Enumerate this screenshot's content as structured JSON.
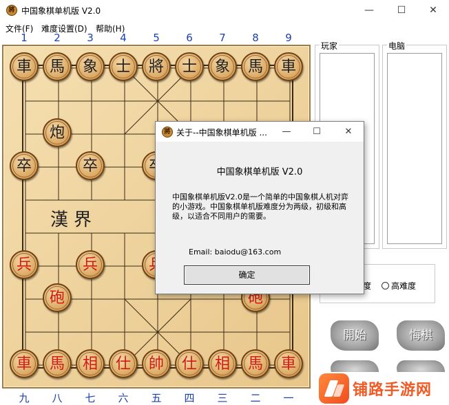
{
  "window": {
    "title": "中国象棋单机版 V2.0",
    "icon_char": "將"
  },
  "menu": [
    "文件(F)",
    "难度设置(D)",
    "帮助(H)"
  ],
  "top_numbers": [
    "1",
    "2",
    "3",
    "4",
    "5",
    "6",
    "7",
    "8",
    "9"
  ],
  "bottom_numbers": [
    "九",
    "八",
    "七",
    "六",
    "五",
    "四",
    "三",
    "二",
    "一"
  ],
  "river_text": "漢界",
  "pieces": [
    {
      "char": "車",
      "side": "black",
      "col": 0,
      "row": 0
    },
    {
      "char": "馬",
      "side": "black",
      "col": 1,
      "row": 0
    },
    {
      "char": "象",
      "side": "black",
      "col": 2,
      "row": 0
    },
    {
      "char": "士",
      "side": "black",
      "col": 3,
      "row": 0
    },
    {
      "char": "將",
      "side": "black",
      "col": 4,
      "row": 0
    },
    {
      "char": "士",
      "side": "black",
      "col": 5,
      "row": 0
    },
    {
      "char": "象",
      "side": "black",
      "col": 6,
      "row": 0
    },
    {
      "char": "馬",
      "side": "black",
      "col": 7,
      "row": 0
    },
    {
      "char": "車",
      "side": "black",
      "col": 8,
      "row": 0
    },
    {
      "char": "炮",
      "side": "black",
      "col": 1,
      "row": 2
    },
    {
      "char": "卒",
      "side": "black",
      "col": 0,
      "row": 3
    },
    {
      "char": "卒",
      "side": "black",
      "col": 2,
      "row": 3
    },
    {
      "char": "卒",
      "side": "black",
      "col": 4,
      "row": 3
    },
    {
      "char": "兵",
      "side": "red",
      "col": 0,
      "row": 6
    },
    {
      "char": "兵",
      "side": "red",
      "col": 2,
      "row": 6
    },
    {
      "char": "兵",
      "side": "red",
      "col": 4,
      "row": 6
    },
    {
      "char": "砲",
      "side": "red",
      "col": 1,
      "row": 7
    },
    {
      "char": "砲",
      "side": "red",
      "col": 7,
      "row": 7
    },
    {
      "char": "車",
      "side": "red",
      "col": 0,
      "row": 9
    },
    {
      "char": "馬",
      "side": "red",
      "col": 1,
      "row": 9
    },
    {
      "char": "相",
      "side": "red",
      "col": 2,
      "row": 9
    },
    {
      "char": "仕",
      "side": "red",
      "col": 3,
      "row": 9
    },
    {
      "char": "帥",
      "side": "red",
      "col": 4,
      "row": 9
    },
    {
      "char": "仕",
      "side": "red",
      "col": 5,
      "row": 9
    },
    {
      "char": "相",
      "side": "red",
      "col": 6,
      "row": 9
    },
    {
      "char": "馬",
      "side": "red",
      "col": 7,
      "row": 9
    },
    {
      "char": "車",
      "side": "red",
      "col": 8,
      "row": 9
    }
  ],
  "panels": {
    "player_label": "玩家",
    "computer_label": "电脑"
  },
  "difficulty": {
    "partial_label": "度",
    "high_label": "高难度"
  },
  "buttons": {
    "start": "開始",
    "undo": "悔棋"
  },
  "dialog": {
    "title": "关于--中国象棋单机版 ...",
    "heading": "中国象棋单机版 V2.0",
    "description": "中国象棋单机版V2.0是一个简单的中国象棋人机对弈的小游戏。中国象棋单机版难度分为两级，初级和高级，以适合不同用户的需要。",
    "email": "Email:  baiodu@163.com",
    "ok_label": "确定"
  },
  "watermark": {
    "text": "铺路手游网"
  }
}
